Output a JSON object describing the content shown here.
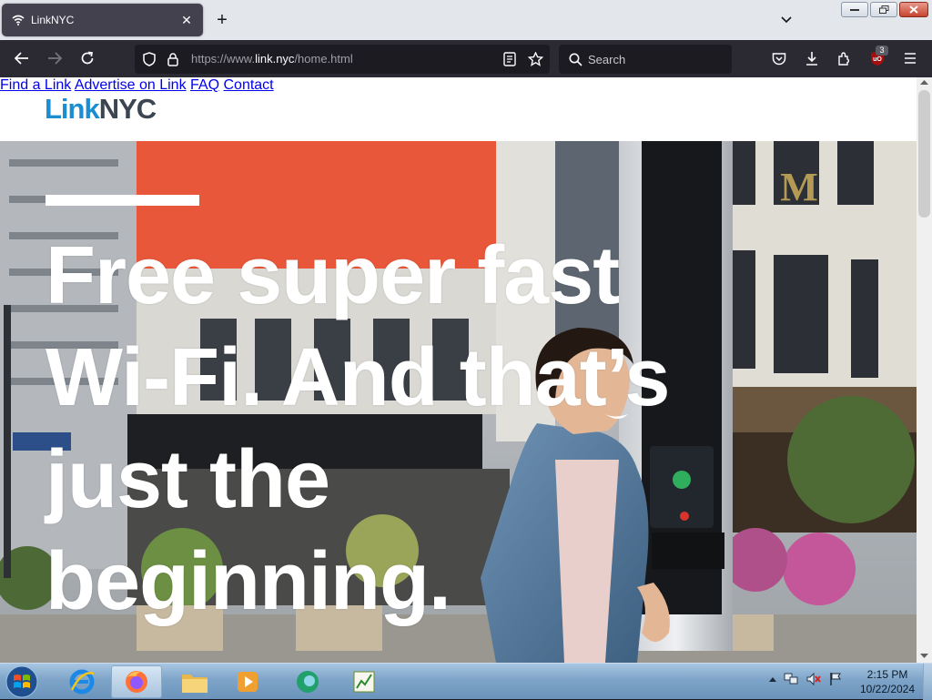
{
  "browser": {
    "tab_title": "LinkNYC",
    "url_prefix": "https://www.",
    "url_domain": "link.nyc",
    "url_path": "/home.html",
    "search_placeholder": "Search",
    "extension_badge": "3"
  },
  "site": {
    "logo_link": "Link",
    "logo_nyc": "NYC",
    "nav": [
      "Find a Link",
      "Advertise on Link",
      "FAQ",
      "Contact"
    ],
    "headline_lines": [
      "Free super fast",
      "Wi-Fi. And that’s",
      "just the",
      "beginning."
    ],
    "colors": {
      "brand_blue": "#1a8ed0",
      "nav_blue": "#1f5f92",
      "logo_grey": "#3b4651"
    }
  },
  "taskbar": {
    "time": "2:15 PM",
    "date": "10/22/2024",
    "apps": [
      "internet-explorer-icon",
      "firefox-icon",
      "file-explorer-icon",
      "media-player-icon",
      "app-icon",
      "task-manager-icon"
    ]
  }
}
